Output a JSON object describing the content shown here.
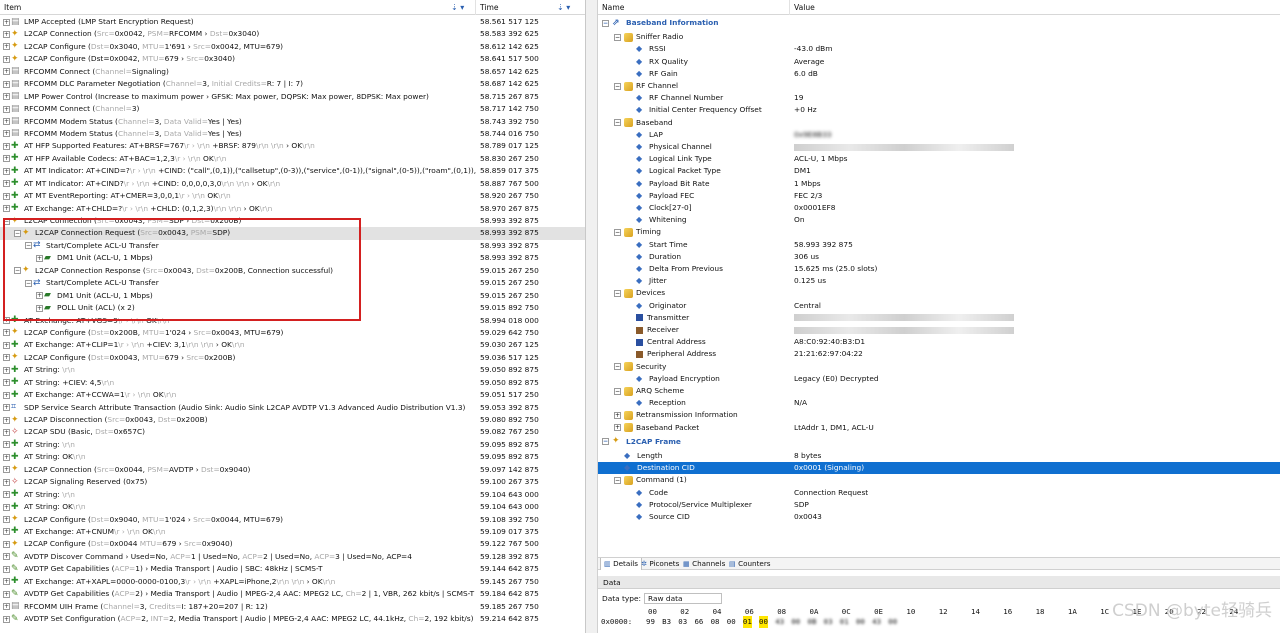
{
  "left_pane": {
    "columns": {
      "item": "Item",
      "time": "Time"
    },
    "rows": [
      {
        "expander": "+",
        "icon": "rfcomm",
        "text": "LMP Accepted (LMP Start Encryption Request)",
        "time": "58.561 517 125"
      },
      {
        "expander": "+",
        "icon": "l2cap",
        "text": "L2CAP Connection (",
        "g1": "Src=",
        "text2": "0x0042, ",
        "g2": "PSM=",
        "text3": "RFCOMM › ",
        "g3": "Dst=",
        "text4": "0x3040)",
        "time": "58.583 392 625"
      },
      {
        "expander": "+",
        "icon": "l2cap",
        "text": "L2CAP Configure (",
        "g1": "Dst=",
        "text2": "0x3040, ",
        "g2": "MTU=",
        "text3": "1'691 › ",
        "g3": "Src=",
        "text4": "0x0042, MTU=679)",
        "time": "58.612 142 625"
      },
      {
        "expander": "+",
        "icon": "l2cap",
        "text": "L2CAP Configure (Dst=0x0042, ",
        "g1": "MTU=",
        "text2": "679 › ",
        "g2": "Src=",
        "text3": "0x3040)",
        "time": "58.641 517 500"
      },
      {
        "expander": "+",
        "icon": "rfcomm",
        "text": "RFCOMM Connect (",
        "g1": "Channel=",
        "text2": "Signaling)",
        "time": "58.657 142 625"
      },
      {
        "expander": "+",
        "icon": "rfcomm",
        "text": "RFCOMM DLC Parameter Negotiation (",
        "g1": "Channel=",
        "text2": "3, ",
        "g2": "Initial Credits=",
        "text3": "R: 7 | I: 7)",
        "time": "58.687 142 625"
      },
      {
        "expander": "+",
        "icon": "rfcomm",
        "text": "LMP Power Control (Increase to maximum power › GFSK: Max power, DQPSK: Max power, 8DPSK: Max power)",
        "time": "58.715 267 875"
      },
      {
        "expander": "+",
        "icon": "rfcomm",
        "text": "RFCOMM Connect (",
        "g1": "Channel=",
        "text2": "3)",
        "time": "58.717 142 750"
      },
      {
        "expander": "+",
        "icon": "rfcomm",
        "text": "RFCOMM Modem Status (",
        "g1": "Channel=",
        "text2": "3, ",
        "g2": "Data Valid=",
        "text3": "Yes | Yes)",
        "time": "58.743 392 750"
      },
      {
        "expander": "+",
        "icon": "rfcomm",
        "text": "RFCOMM Modem Status (",
        "g1": "Channel=",
        "text2": "3, ",
        "g2": "Data Valid=",
        "text3": "Yes | Yes)",
        "time": "58.744 016 750"
      },
      {
        "expander": "+",
        "icon": "at",
        "text": "AT HFP Supported Features: AT+BRSF=767",
        "g1": "\\r › \\r\\n",
        "text2": " +BRSF: 879",
        "g2": "\\r\\n \\r\\n",
        "text3": " › OK",
        "g3": "\\r\\n",
        "time": "58.789 017 125"
      },
      {
        "expander": "+",
        "icon": "at",
        "text": "AT HFP Available Codecs: AT+BAC=1,2,3",
        "g1": "\\r › \\r\\n",
        "text2": " OK",
        "g2": "\\r\\n",
        "time": "58.830 267 250"
      },
      {
        "expander": "+",
        "icon": "at",
        "text": "AT MT Indicator: AT+CIND=?",
        "g1": "\\r › \\r\\n",
        "text2": " +CIND: (\"call\",(0,1)),(\"callsetup\",(0-3)),(\"service\",(0-1)),(\"signal\",(0-5)),(\"roam\",(0,1)),(\"batch...",
        "time": "58.859 017 375"
      },
      {
        "expander": "+",
        "icon": "at",
        "text": "AT MT Indicator: AT+CIND?",
        "g1": "\\r › \\r\\n",
        "text2": " +CIND: 0,0,0,0,3,0",
        "g2": "\\r\\n \\r\\n",
        "text3": " › OK",
        "g3": "\\r\\n",
        "time": "58.887 767 500"
      },
      {
        "expander": "+",
        "icon": "at",
        "text": "AT MT EventReporting: AT+CMER=3,0,0,1",
        "g1": "\\r › \\r\\n",
        "text2": " OK",
        "g2": "\\r\\n",
        "time": "58.920 267 750"
      },
      {
        "expander": "+",
        "icon": "at",
        "text": "AT Exchange: AT+CHLD=?",
        "g1": "\\r › \\r\\n",
        "text2": " +CHLD: (0,1,2,3)",
        "g2": "\\r\\n \\r\\n",
        "text3": " › OK",
        "g3": "\\r\\n",
        "time": "58.970 267 875"
      },
      {
        "expander": "−",
        "icon": "l2cap",
        "text": "L2CAP Connection (",
        "g1": "Src=",
        "text2": "0x0043, ",
        "g2": "PSM=",
        "text3": "SDP › ",
        "g3": "Dst=",
        "text4": "0x200B)",
        "time": "58.993 392 875"
      },
      {
        "indent": 1,
        "expander": "−",
        "icon": "l2cap",
        "sel": true,
        "text": "L2CAP Connection Request (",
        "g1": "Src=",
        "text2": "0x0043, ",
        "g2": "PSM=",
        "text3": "SDP)",
        "time": "58.993 392 875"
      },
      {
        "indent": 2,
        "expander": "−",
        "icon": "transfer",
        "text": "Start/Complete ACL-U Transfer",
        "time": "58.993 392 875"
      },
      {
        "indent": 3,
        "expander": "+",
        "icon": "dm1",
        "text": "DM1 Unit (ACL-U, 1 Mbps)",
        "time": "58.993 392 875"
      },
      {
        "indent": 1,
        "expander": "−",
        "icon": "l2cap",
        "text": "L2CAP Connection Response (",
        "g1": "Src=",
        "text2": "0x0043, ",
        "g2": "Dst=",
        "text3": "0x200B, Connection successful)",
        "time": "59.015 267 250"
      },
      {
        "indent": 2,
        "expander": "−",
        "icon": "transfer",
        "text": "Start/Complete ACL-U Transfer",
        "time": "59.015 267 250"
      },
      {
        "indent": 3,
        "expander": "+",
        "icon": "dm1",
        "text": "DM1 Unit (ACL-U, 1 Mbps)",
        "time": "59.015 267 250"
      },
      {
        "indent": 3,
        "expander": "+",
        "icon": "dm1",
        "text": "POLL Unit (ACL) (x 2)",
        "time": "59.015 892 750"
      },
      {
        "expander": "+",
        "icon": "at",
        "text": "AT Exchange: AT+VGS=9",
        "g1": "\\r › \\r\\n",
        "text2": " OK",
        "g2": "\\r\\n",
        "time": "58.994 018 000"
      },
      {
        "expander": "+",
        "icon": "l2cap",
        "text": "L2CAP Configure (",
        "g1": "Dst=",
        "text2": "0x200B, ",
        "g2": "MTU=",
        "text3": "1'024 › ",
        "g3": "Src=",
        "text4": "0x0043, MTU=679)",
        "time": "59.029 642 750"
      },
      {
        "expander": "+",
        "icon": "at",
        "text": "AT Exchange: AT+CLIP=1",
        "g1": "\\r › \\r\\n",
        "text2": " +CIEV: 3,1",
        "g2": "\\r\\n \\r\\n",
        "text3": " › OK",
        "g3": "\\r\\n",
        "time": "59.030 267 125"
      },
      {
        "expander": "+",
        "icon": "l2cap",
        "text": "L2CAP Configure (",
        "g1": "Dst=",
        "text2": "0x0043, ",
        "g2": "MTU=",
        "text3": "679 › ",
        "g3": "Src=",
        "text4": "0x200B)",
        "time": "59.036 517 125"
      },
      {
        "expander": "+",
        "icon": "at",
        "text": "AT String: ",
        "g1": "\\r\\n",
        "time": "59.050 892 875"
      },
      {
        "expander": "+",
        "icon": "at",
        "text": "AT String: +CIEV: 4,5",
        "g1": "\\r\\n",
        "time": "59.050 892 875"
      },
      {
        "expander": "+",
        "icon": "at",
        "text": "AT Exchange: AT+CCWA=1",
        "g1": "\\r › \\r\\n",
        "text2": " OK",
        "g2": "\\r\\n",
        "time": "59.051 517 250"
      },
      {
        "expander": "+",
        "icon": "sdp",
        "text": "SDP Service Search Attribute Transaction (Audio Sink: Audio Sink L2CAP AVDTP V1.3 Advanced Audio Distribution V1.3)",
        "time": "59.053 392 875"
      },
      {
        "expander": "+",
        "icon": "l2cap",
        "text": "L2CAP Disconnection (",
        "g1": "Src=",
        "text2": "0x0043, ",
        "g2": "Dst=",
        "text3": "0x200B)",
        "time": "59.080 892 750"
      },
      {
        "expander": "+",
        "icon": "sdu",
        "text": "L2CAP SDU (Basic, ",
        "g1": "Dst=",
        "text2": "0x657C)",
        "time": "59.082 767 250"
      },
      {
        "expander": "+",
        "icon": "at",
        "text": "AT String: ",
        "g1": "\\r\\n",
        "time": "59.095 892 875"
      },
      {
        "expander": "+",
        "icon": "at",
        "text": "AT String: OK",
        "g1": "\\r\\n",
        "time": "59.095 892 875"
      },
      {
        "expander": "+",
        "icon": "l2cap",
        "text": "L2CAP Connection (",
        "g1": "Src=",
        "text2": "0x0044, ",
        "g2": "PSM=",
        "text3": "AVDTP › ",
        "g3": "Dst=",
        "text4": "0x9040)",
        "time": "59.097 142 875"
      },
      {
        "expander": "+",
        "icon": "sdu",
        "text": "L2CAP Signaling Reserved (0x75)",
        "time": "59.100 267 375"
      },
      {
        "expander": "+",
        "icon": "at",
        "text": "AT String: ",
        "g1": "\\r\\n",
        "time": "59.104 643 000"
      },
      {
        "expander": "+",
        "icon": "at",
        "text": "AT String: OK",
        "g1": "\\r\\n",
        "time": "59.104 643 000"
      },
      {
        "expander": "+",
        "icon": "l2cap",
        "text": "L2CAP Configure (",
        "g1": "Dst=",
        "text2": "0x9040, ",
        "g2": "MTU=",
        "text3": "1'024 › ",
        "g3": "Src=",
        "text4": "0x0044, MTU=679)",
        "time": "59.108 392 750"
      },
      {
        "expander": "+",
        "icon": "at",
        "text": "AT Exchange: AT+CNUM",
        "g1": "\\r › \\r\\n",
        "text2": " OK",
        "g2": "\\r\\n",
        "time": "59.109 017 375"
      },
      {
        "expander": "+",
        "icon": "l2cap",
        "text": "L2CAP Configure (",
        "g1": "Dst=",
        "text2": "0x0044 ",
        "g2": "MTU=",
        "text3": "679 › ",
        "g3": "Src=",
        "text4": "0x9040)",
        "time": "59.122 767 500"
      },
      {
        "expander": "+",
        "icon": "avdtp",
        "text": "AVDTP Discover Command › Used=No, ",
        "g1": "ACP=",
        "text2": "1 | Used=No, ",
        "g2": "ACP=",
        "text3": "2 | Used=No, ",
        "g3": "ACP=",
        "text4": "3 | Used=No, ACP=4",
        "time": "59.128 392 875"
      },
      {
        "expander": "+",
        "icon": "avdtp",
        "text": "AVDTP Get Capabilities (",
        "g1": "ACP=",
        "text2": "1) › Media Transport | Audio | SBC: 48kHz | SCMS-T",
        "time": "59.144 642 875"
      },
      {
        "expander": "+",
        "icon": "at",
        "text": "AT Exchange: AT+XAPL=0000-0000-0100,3",
        "g1": "\\r › \\r\\n",
        "text2": " +XAPL=iPhone,2",
        "g2": "\\r\\n \\r\\n",
        "text3": " › OK",
        "g3": "\\r\\n",
        "time": "59.145 267 750"
      },
      {
        "expander": "+",
        "icon": "avdtp",
        "text": "AVDTP Get Capabilities (",
        "g1": "ACP=",
        "text2": "2) › Media Transport | Audio | MPEG-2,4 AAC: MPEG2 LC, ",
        "g2": "Ch=",
        "text3": "2 | 1, VBR, 262 kbit/s | SCMS-T",
        "time": "59.184 642 875"
      },
      {
        "expander": "+",
        "icon": "rfcomm",
        "text": "RFCOMM UIH Frame (",
        "g1": "Channel=",
        "text2": "3, ",
        "g2": "Credits=",
        "text3": "I: 187+20=207 | R: 12)",
        "time": "59.185 267 750"
      },
      {
        "expander": "+",
        "icon": "avdtp",
        "text": "AVDTP Set Configuration (",
        "g1": "ACP=",
        "text2": "2, ",
        "g2": "INT=",
        "text3": "2, Media Transport | Audio | MPEG-2,4 AAC: MPEG2 LC, 44.1kHz, ",
        "g3": "Ch=",
        "text4": "2, 192 kbit/s)",
        "time": "59.214 642 875"
      }
    ]
  },
  "right_pane": {
    "columns": {
      "name": "Name",
      "value": "Value"
    },
    "rows": [
      {
        "kind": "section",
        "level": 0,
        "name": "Baseband Information",
        "value": ""
      },
      {
        "kind": "group",
        "level": 1,
        "name": "Sniffer Radio",
        "value": ""
      },
      {
        "kind": "leaf",
        "level": 2,
        "name": "RSSI",
        "value": "-43.0 dBm"
      },
      {
        "kind": "leaf",
        "level": 2,
        "name": "RX Quality",
        "value": "Average"
      },
      {
        "kind": "leaf",
        "level": 2,
        "name": "RF Gain",
        "value": "6.0 dB"
      },
      {
        "kind": "group",
        "level": 1,
        "name": "RF Channel",
        "value": ""
      },
      {
        "kind": "leaf",
        "level": 2,
        "name": "RF Channel Number",
        "value": "19"
      },
      {
        "kind": "leaf",
        "level": 2,
        "name": "Initial Center Frequency Offset",
        "value": "+0 Hz"
      },
      {
        "kind": "group",
        "level": 1,
        "name": "Baseband",
        "value": ""
      },
      {
        "kind": "leaf",
        "level": 2,
        "name": "LAP",
        "value": "0x9E8B33",
        "blur": true
      },
      {
        "kind": "leaf",
        "level": 2,
        "name": "Physical Channel",
        "value": "",
        "blur": true
      },
      {
        "kind": "leaf",
        "level": 2,
        "name": "Logical Link Type",
        "value": "ACL-U, 1 Mbps"
      },
      {
        "kind": "leaf",
        "level": 2,
        "name": "Logical Packet Type",
        "value": "DM1"
      },
      {
        "kind": "leaf",
        "level": 2,
        "name": "Payload Bit Rate",
        "value": "1 Mbps"
      },
      {
        "kind": "leaf",
        "level": 2,
        "name": "Payload FEC",
        "value": "FEC 2/3"
      },
      {
        "kind": "leaf",
        "level": 2,
        "name": "Clock[27-0]",
        "value": "0x0001EF8"
      },
      {
        "kind": "leaf",
        "level": 2,
        "name": "Whitening",
        "value": "On"
      },
      {
        "kind": "group",
        "level": 1,
        "name": "Timing",
        "value": ""
      },
      {
        "kind": "leaf",
        "level": 2,
        "name": "Start Time",
        "value": "58.993 392 875"
      },
      {
        "kind": "leaf",
        "level": 2,
        "name": "Duration",
        "value": "306 us"
      },
      {
        "kind": "leaf",
        "level": 2,
        "name": "Delta From Previous",
        "value": "15.625 ms (25.0 slots)"
      },
      {
        "kind": "leaf",
        "level": 2,
        "name": "Jitter",
        "value": "0.125 us"
      },
      {
        "kind": "group",
        "level": 1,
        "name": "Devices",
        "value": ""
      },
      {
        "kind": "leaf",
        "level": 2,
        "name": "Originator",
        "value": "Central"
      },
      {
        "kind": "swatch",
        "level": 2,
        "name": "Transmitter",
        "value": "",
        "color": "#2a4fa0",
        "blur": true
      },
      {
        "kind": "swatch",
        "level": 2,
        "name": "Receiver",
        "value": "",
        "color": "#8a5a2a",
        "blur": true
      },
      {
        "kind": "swatch",
        "level": 2,
        "name": "Central Address",
        "value": "A8:C0:92:40:B3:D1",
        "color": "#2a4fa0"
      },
      {
        "kind": "swatch",
        "level": 2,
        "name": "Peripheral Address",
        "value": "21:21:62:97:04:22",
        "color": "#8a5a2a"
      },
      {
        "kind": "group",
        "level": 1,
        "name": "Security",
        "value": ""
      },
      {
        "kind": "leaf",
        "level": 2,
        "name": "Payload Encryption",
        "value": "Legacy (E0) Decrypted"
      },
      {
        "kind": "group",
        "level": 1,
        "name": "ARQ Scheme",
        "value": ""
      },
      {
        "kind": "leaf",
        "level": 2,
        "name": "Reception",
        "value": "N/A"
      },
      {
        "kind": "group",
        "level": 1,
        "expander": "+",
        "name": "Retransmission Information",
        "value": ""
      },
      {
        "kind": "group",
        "level": 1,
        "expander": "+",
        "name": "Baseband Packet",
        "value": "LtAddr 1, DM1, ACL-U"
      },
      {
        "kind": "section",
        "level": 0,
        "name": "L2CAP Frame",
        "value": "",
        "icon": "l2cap"
      },
      {
        "kind": "leaf",
        "level": 1,
        "name": "Length",
        "value": "8 bytes"
      },
      {
        "kind": "leaf",
        "level": 1,
        "name": "Destination CID",
        "value": "0x0001 (Signaling)",
        "sel": true
      },
      {
        "kind": "group",
        "level": 1,
        "name": "Command (1)",
        "value": ""
      },
      {
        "kind": "leaf",
        "level": 2,
        "name": "Code",
        "value": "Connection Request"
      },
      {
        "kind": "leaf",
        "level": 2,
        "name": "Protocol/Service Multiplexer",
        "value": "SDP"
      },
      {
        "kind": "leaf",
        "level": 2,
        "name": "Source CID",
        "value": "0x0043"
      }
    ],
    "tabs": [
      "Details",
      "Piconets",
      "Channels",
      "Counters"
    ],
    "data_panel": {
      "title": "Data",
      "type_label": "Data type:",
      "type_value": "Raw data",
      "offsets": [
        "00",
        "02",
        "04",
        "06",
        "08",
        "0A",
        "0C",
        "0E",
        "10",
        "12",
        "14",
        "16",
        "18",
        "1A",
        "1C",
        "1E",
        "20",
        "22",
        "24"
      ],
      "row_label": "0x0000:",
      "bytes": [
        "99",
        "B3",
        "03",
        "66",
        "08",
        "00",
        "01",
        "00",
        "43",
        "00",
        "0B",
        "03",
        "01",
        "00",
        "43",
        "00"
      ],
      "highlight": [
        6,
        7
      ]
    },
    "watermark": "CSDN @byte轻骑兵"
  }
}
